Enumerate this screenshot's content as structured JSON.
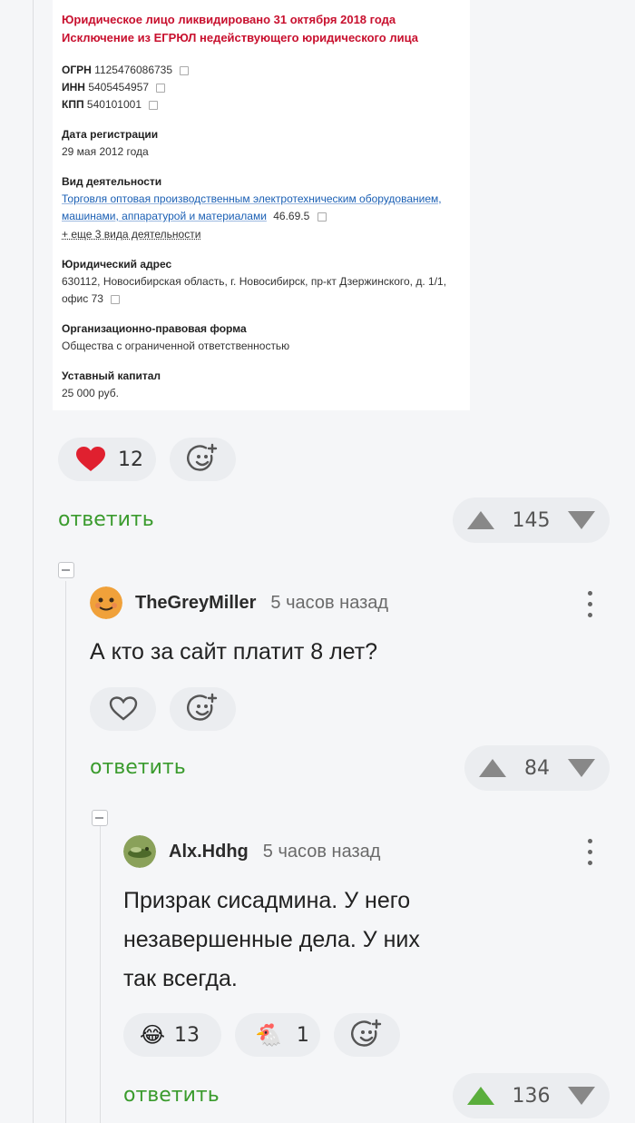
{
  "card": {
    "status_line1": "Юридическое лицо ликвидировано 31 октября 2018 года",
    "status_line2": "Исключение из ЕГРЮЛ недействующего юридического лица",
    "ogrn_label": "ОГРН",
    "ogrn_value": "1125476086735",
    "inn_label": "ИНН",
    "inn_value": "5405454957",
    "kpp_label": "КПП",
    "kpp_value": "540101001",
    "reg_label": "Дата регистрации",
    "reg_value": "29 мая 2012 года",
    "activity_label": "Вид деятельности",
    "activity_line1": "Торговля оптовая производственным электротехническим оборудованием,",
    "activity_line2": "машинами, аппаратурой и материалами",
    "activity_code": "46.69.5",
    "activity_more": "+ еще 3 вида деятельности",
    "address_label": "Юридический адрес",
    "address_line1": "630112, Новосибирская область, г. Новосибирск, пр-кт Дзержинского, д. 1/1,",
    "address_line2": "офис 73",
    "form_label": "Организационно-правовая форма",
    "form_value": "Общества с ограниченной ответственностью",
    "capital_label": "Уставный капитал",
    "capital_value": "25 000 руб."
  },
  "post": {
    "like_count": "12",
    "reply_label": "ответить",
    "rating": "145"
  },
  "comments": [
    {
      "author": "TheGreyMiller",
      "time": "5 часов назад",
      "text": "А кто за сайт платит 8 лет?",
      "reply_label": "ответить",
      "rating": "84"
    },
    {
      "author": "Alx.Hdhg",
      "time": "5 часов назад",
      "text_line1": "Призрак сисадмина. У него",
      "text_line2": "незавершенные дела. У них",
      "text_line3": "так всегда.",
      "reaction1_emoji": "😂",
      "reaction1_count": "13",
      "reaction2_emoji": "🐔",
      "reaction2_count": "1",
      "reply_label": "ответить",
      "rating": "136"
    }
  ],
  "colors": {
    "accent_green": "#3a9b2d",
    "upvote_active": "#5aae3c",
    "heart_red": "#e0202f",
    "status_red": "#c8102e"
  }
}
